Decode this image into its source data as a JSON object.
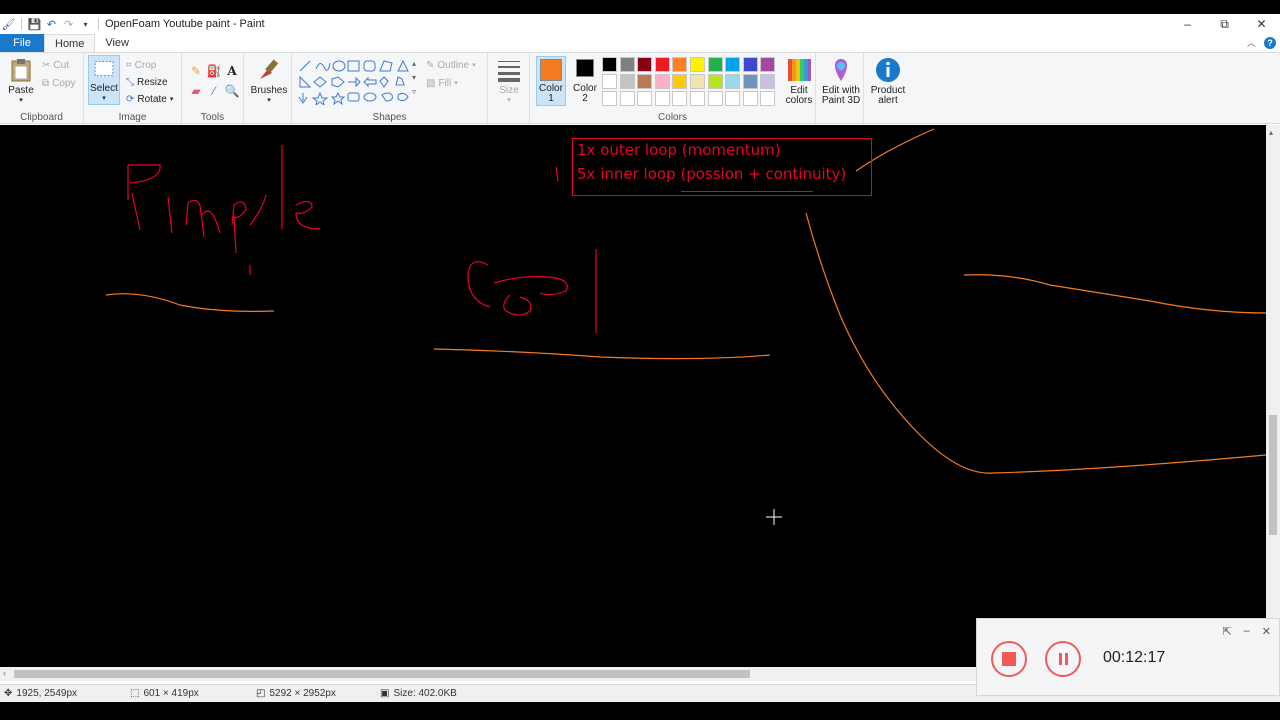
{
  "window": {
    "title": "OpenFoam Youtube paint - Paint",
    "minimize": "–",
    "restore": "⧉",
    "close": "✕"
  },
  "tabs": {
    "file": "File",
    "home": "Home",
    "view": "View"
  },
  "clipboard": {
    "paste": "Paste",
    "cut": "Cut",
    "copy": "Copy",
    "label": "Clipboard"
  },
  "image": {
    "select": "Select",
    "crop": "Crop",
    "resize": "Resize",
    "rotate": "Rotate",
    "label": "Image"
  },
  "tools": {
    "label": "Tools",
    "brushes": "Brushes"
  },
  "shapes": {
    "outline": "Outline",
    "fill": "Fill",
    "label": "Shapes"
  },
  "size": {
    "label": "Size"
  },
  "colors": {
    "color1": "Color",
    "color1_num": "1",
    "color2": "Color",
    "color2_num": "2",
    "label": "Colors",
    "edit_colors_line1": "Edit",
    "edit_colors_line2": "colors",
    "color1_value": "#f47b20",
    "color2_value": "#000000",
    "palette_row1": [
      "#000000",
      "#7f7f7f",
      "#880015",
      "#ed1c24",
      "#ff7f27",
      "#fff200",
      "#22b14c",
      "#00a2e8",
      "#3f48cc",
      "#a349a4"
    ],
    "palette_row2": [
      "#ffffff",
      "#c3c3c3",
      "#b97a57",
      "#ffaec9",
      "#ffc90e",
      "#efe4b0",
      "#b5e61d",
      "#99d9ea",
      "#7092be",
      "#c8bfe7"
    ]
  },
  "paint3d": {
    "line1": "Edit with",
    "line2": "Paint 3D"
  },
  "product_alert": {
    "line1": "Product",
    "line2": "alert"
  },
  "canvas": {
    "text_line1": "1x outer loop (momentum)",
    "text_line2": "5x inner loop (possion + continuity)"
  },
  "status": {
    "cursor_pos": "1925, 2549px",
    "selection_size": "601 × 419px",
    "image_size": "5292 × 2952px",
    "file_size": "Size: 402.0KB"
  },
  "recorder": {
    "timer": "00:12:17"
  }
}
